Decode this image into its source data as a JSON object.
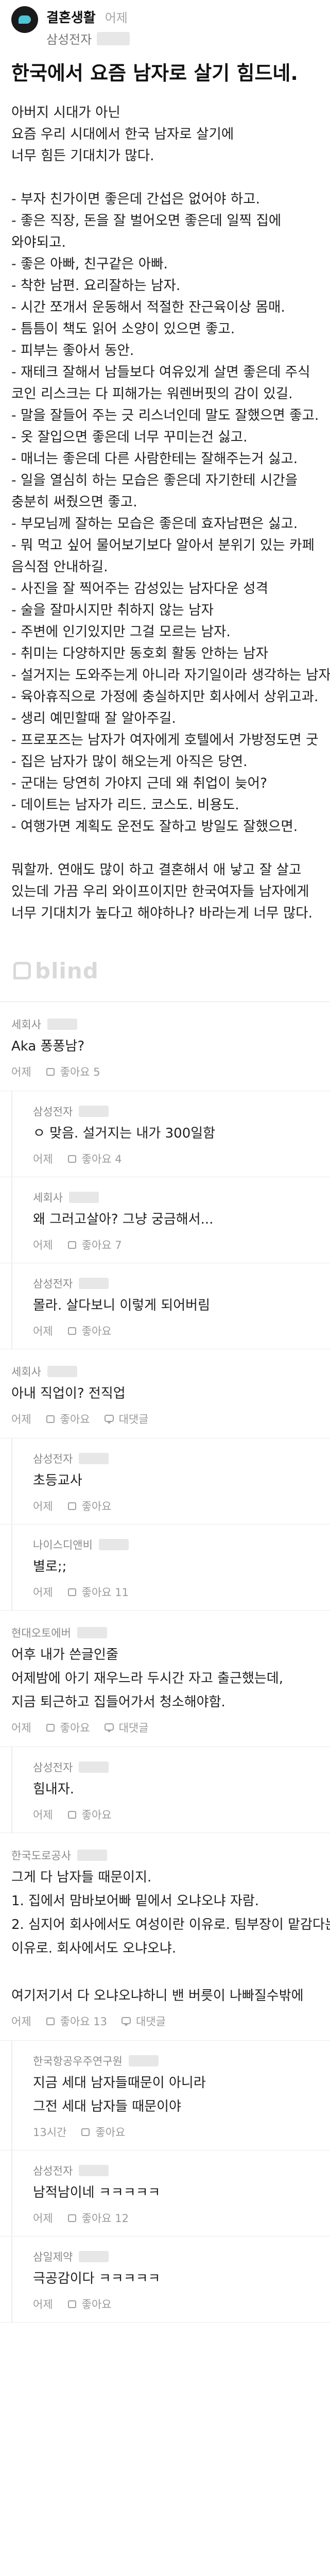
{
  "header": {
    "board": "결혼생활",
    "time": "어제",
    "company": "삼성전자"
  },
  "post": {
    "title": "한국에서 요즘 남자로 살기 힘드네.",
    "lines": [
      "아버지 시대가 아닌",
      "요즘 우리 시대에서 한국 남자로 살기에",
      "너무 힘든 기대치가 많다.",
      "",
      "- 부자 친가이면 좋은데 간섭은 없어야 하고.",
      "- 좋은 직장, 돈을 잘 벌어오면 좋은데 일찍 집에",
      "와야되고.",
      "- 좋은 아빠, 친구같은 아빠.",
      "- 착한 남편. 요리잘하는 남자.",
      "- 시간 쪼개서 운동해서 적절한 잔근육이상 몸매.",
      "- 틈틈이 책도 읽어 소양이 있으면 좋고.",
      "- 피부는 좋아서 동안.",
      "- 재테크 잘해서 남들보다 여유있게 살면 좋은데 주식",
      "코인 리스크는 다 피해가는 워렌버핏의 감이 있길.",
      "- 말을 잘들어 주는 긋 리스너인데 말도 잘했으면 좋고.",
      "- 옷 잘입으면 좋은데 너무 꾸미는건 싫고.",
      "- 매너는 좋은데 다른 사람한테는 잘해주는거 싫고.",
      "- 일을 열심히 하는 모습은 좋은데 자기한테 시간을",
      "충분히 써줬으면 좋고.",
      "- 부모님께 잘하는 모습은 좋은데 효자남편은 싫고.",
      "- 뭐 먹고 싶어 물어보기보다 알아서 분위기 있는 카페",
      "음식점 안내하길.",
      "- 사진을 잘 찍어주는 감성있는 남자다운 성격",
      "- 술을 잘마시지만 취하지 않는 남자",
      "- 주변에 인기있지만 그걸 모르는 남자.",
      "- 취미는 다양하지만 동호회 활동 안하는 남자",
      "- 설거지는 도와주는게 아니라 자기일이라 생각하는 남자",
      "- 육아휴직으로 가정에 충실하지만 회사에서 상위고과.",
      "- 생리 예민할때 잘 알아주길.",
      "- 프로포즈는 남자가 여자에게 호텔에서 가방정도면 굿",
      "- 집은 남자가 많이 해오는게 아직은 당연.",
      "- 군대는 당연히 가야지 근데 왜 취업이 늦어?",
      "- 데이트는 남자가 리드. 코스도. 비용도.",
      "- 여행가면 계획도 운전도 잘하고 방일도 잘했으면.",
      "",
      "뭐할까. 연애도 많이 하고 결혼해서 애 낳고 잘 살고",
      "있는데 가끔 우리 와이프이지만 한국여자들 남자에게",
      "너무 기대치가 높다고 해야하나? 바라는게 너무 많다."
    ]
  },
  "blind_logo": "blind",
  "comments": [
    {
      "reply": false,
      "author": "세회사",
      "text": [
        "Aka 퐁퐁남?"
      ],
      "time": "어제",
      "like": "좋아요 5",
      "reply_count": ""
    },
    {
      "reply": true,
      "author": "삼성전자",
      "text": [
        "ㅇ 맞음. 설거지는 내가 300일함"
      ],
      "time": "어제",
      "like": "좋아요 4",
      "reply_count": ""
    },
    {
      "reply": true,
      "author": "세회사",
      "text": [
        "왜 그러고살아? 그냥 궁금해서..."
      ],
      "time": "어제",
      "like": "좋아요 7",
      "reply_count": ""
    },
    {
      "reply": true,
      "author": "삼성전자",
      "text": [
        "몰라. 살다보니 이렇게 되어버림"
      ],
      "time": "어제",
      "like": "좋아요",
      "reply_count": ""
    },
    {
      "reply": false,
      "author": "세회사",
      "text": [
        "아내 직업이? 전직업"
      ],
      "time": "어제",
      "like": "좋아요",
      "reply_count": "대댓글"
    },
    {
      "reply": true,
      "author": "삼성전자",
      "text": [
        "초등교사"
      ],
      "time": "어제",
      "like": "좋아요",
      "reply_count": ""
    },
    {
      "reply": true,
      "author": "나이스디앤비",
      "text": [
        "별로;;"
      ],
      "time": "어제",
      "like": "좋아요 11",
      "reply_count": ""
    },
    {
      "reply": false,
      "author": "현대오토에버",
      "text": [
        "어후 내가 쓴글인줄",
        "어제밤에 아기 재우느라 두시간 자고 출근했는데,",
        "지금 퇴근하고 집들어가서 청소해야함."
      ],
      "time": "어제",
      "like": "좋아요",
      "reply_count": "대댓글"
    },
    {
      "reply": true,
      "author": "삼성전자",
      "text": [
        "힘내자."
      ],
      "time": "어제",
      "like": "좋아요",
      "reply_count": ""
    },
    {
      "reply": false,
      "author": "한국도로공사",
      "text": [
        "그게 다 남자들 때문이지.",
        "1. 집에서 맘바보어빠 밑에서 오냐오냐 자람.",
        "2. 심지어 회사에서도 여성이란 이유로. 팀부장이 맡감다는",
        "이유로. 회사에서도 오냐오냐.",
        "",
        "여기저기서 다 오냐오냐하니 밴 버릇이 나빠질수밖에"
      ],
      "time": "어제",
      "like": "좋아요 13",
      "reply_count": "대댓글"
    },
    {
      "reply": true,
      "author": "한국항공우주연구원",
      "text": [
        "지금 세대 남자들때문이 아니라",
        "그전 세대 남자들 때문이야"
      ],
      "time": "13시간",
      "like": "좋아요",
      "reply_count": ""
    },
    {
      "reply": true,
      "author": "삼성전자",
      "text": [
        "남적남이네 ㅋㅋㅋㅋㅋ"
      ],
      "time": "어제",
      "like": "좋아요 12",
      "reply_count": ""
    },
    {
      "reply": true,
      "author": "삼일제약",
      "text": [
        "극공감이다 ㅋㅋㅋㅋㅋ"
      ],
      "time": "어제",
      "like": "좋아요",
      "reply_count": ""
    }
  ]
}
